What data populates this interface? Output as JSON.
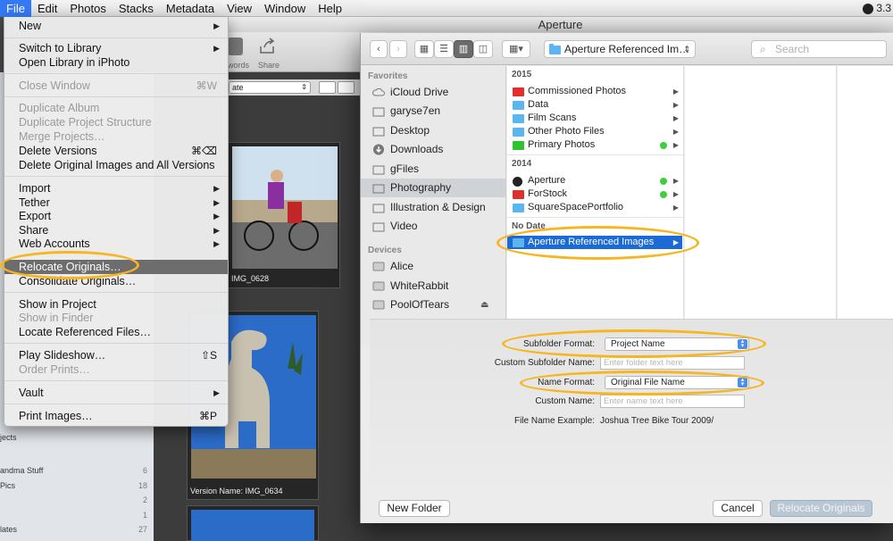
{
  "menubar": {
    "items": [
      "File",
      "Edit",
      "Photos",
      "Stacks",
      "Metadata",
      "View",
      "Window",
      "Help"
    ],
    "right_text": "3.3"
  },
  "app": {
    "title": "Aperture",
    "toolbar": {
      "keywords_label": "words",
      "share_label": "Share"
    },
    "browser_select": "ate",
    "left_pane": [
      {
        "label": "jects",
        "count": ""
      },
      {
        "label": "andma Stuff",
        "count": "6"
      },
      {
        "label": "Pics",
        "count": "18"
      },
      {
        "label": "",
        "count": "2"
      },
      {
        "label": "",
        "count": "1"
      },
      {
        "label": "lates",
        "count": "27"
      }
    ],
    "thumbs": [
      {
        "caption": "IMG_0628"
      },
      {
        "caption": "Version Name: IMG_0634"
      }
    ]
  },
  "file_menu": {
    "items": [
      {
        "label": "New",
        "shortcut": "",
        "submenu": true,
        "disabled": false
      },
      {
        "label": "Switch to Library",
        "shortcut": "",
        "submenu": true,
        "disabled": false
      },
      {
        "label": "Open Library in iPhoto",
        "shortcut": "",
        "submenu": false,
        "disabled": false
      },
      {
        "label": "Close Window",
        "shortcut": "⌘W",
        "submenu": false,
        "disabled": true
      },
      {
        "label": "Duplicate Album",
        "shortcut": "",
        "submenu": false,
        "disabled": true
      },
      {
        "label": "Duplicate Project Structure",
        "shortcut": "",
        "submenu": false,
        "disabled": true
      },
      {
        "label": "Merge Projects…",
        "shortcut": "",
        "submenu": false,
        "disabled": true
      },
      {
        "label": "Delete Versions",
        "shortcut": "⌘⌫",
        "submenu": false,
        "disabled": false
      },
      {
        "label": "Delete Original Images and All Versions",
        "shortcut": "",
        "submenu": false,
        "disabled": false
      },
      {
        "label": "Import",
        "shortcut": "",
        "submenu": true,
        "disabled": false
      },
      {
        "label": "Tether",
        "shortcut": "",
        "submenu": true,
        "disabled": false
      },
      {
        "label": "Export",
        "shortcut": "",
        "submenu": true,
        "disabled": false
      },
      {
        "label": "Share",
        "shortcut": "",
        "submenu": true,
        "disabled": false
      },
      {
        "label": "Web Accounts",
        "shortcut": "",
        "submenu": true,
        "disabled": false
      },
      {
        "label": "Relocate Originals…",
        "shortcut": "",
        "submenu": false,
        "disabled": false
      },
      {
        "label": "Consolidate Originals…",
        "shortcut": "",
        "submenu": false,
        "disabled": false
      },
      {
        "label": "Show in Project",
        "shortcut": "",
        "submenu": false,
        "disabled": false
      },
      {
        "label": "Show in Finder",
        "shortcut": "",
        "submenu": false,
        "disabled": true
      },
      {
        "label": "Locate Referenced Files…",
        "shortcut": "",
        "submenu": false,
        "disabled": false
      },
      {
        "label": "Play Slideshow…",
        "shortcut": "⇧S",
        "submenu": false,
        "disabled": false
      },
      {
        "label": "Order Prints…",
        "shortcut": "",
        "submenu": false,
        "disabled": true
      },
      {
        "label": "Vault",
        "shortcut": "",
        "submenu": true,
        "disabled": false
      },
      {
        "label": "Print Images…",
        "shortcut": "⌘P",
        "submenu": false,
        "disabled": false
      }
    ]
  },
  "dialog": {
    "path": "Aperture Referenced Im…",
    "search_placeholder": "Search",
    "sidebar": {
      "favorites_header": "Favorites",
      "favorites": [
        "iCloud Drive",
        "garyse7en",
        "Desktop",
        "Downloads",
        "gFiles",
        "Photography",
        "Illustration & Design",
        "Video"
      ],
      "devices_header": "Devices",
      "devices": [
        "Alice",
        "WhiteRabbit",
        "PoolOfTears"
      ]
    },
    "column": {
      "groups": [
        {
          "header": "2015",
          "items": [
            {
              "label": "Commissioned Photos",
              "color": "#e0302a",
              "tag": false
            },
            {
              "label": "Data",
              "color": "#5bb6f0",
              "tag": false
            },
            {
              "label": "Film Scans",
              "color": "#5bb6f0",
              "tag": false
            },
            {
              "label": "Other Photo Files",
              "color": "#5bb6f0",
              "tag": false
            },
            {
              "label": "Primary Photos",
              "color": "#2fc42f",
              "tag": true
            }
          ]
        },
        {
          "header": "2014",
          "items": [
            {
              "label": "Aperture",
              "color": "#222222",
              "tag": true
            },
            {
              "label": "ForStock",
              "color": "#e0302a",
              "tag": true
            },
            {
              "label": "SquareSpacePortfolio",
              "color": "#5bb6f0",
              "tag": false
            }
          ]
        },
        {
          "header": "No Date",
          "items": [
            {
              "label": "Aperture Referenced Images",
              "color": "#5bb6f0",
              "tag": false
            }
          ]
        }
      ]
    },
    "options": {
      "subfolder_format_label": "Subfolder Format:",
      "subfolder_format_value": "Project Name",
      "custom_subfolder_label": "Custom Subfolder Name:",
      "custom_subfolder_placeholder": "Enter folder text here",
      "name_format_label": "Name Format:",
      "name_format_value": "Original File Name",
      "custom_name_label": "Custom Name:",
      "custom_name_placeholder": "Enter name text here",
      "example_label": "File Name Example:",
      "example_value": "Joshua Tree Bike Tour 2009/"
    },
    "buttons": {
      "new_folder": "New Folder",
      "cancel": "Cancel",
      "relocate": "Relocate Originals"
    }
  },
  "colors": {
    "selection_blue": "#1b6ad6",
    "highlight": "#f7b51f",
    "menu_selected": "#6d6d6d"
  }
}
